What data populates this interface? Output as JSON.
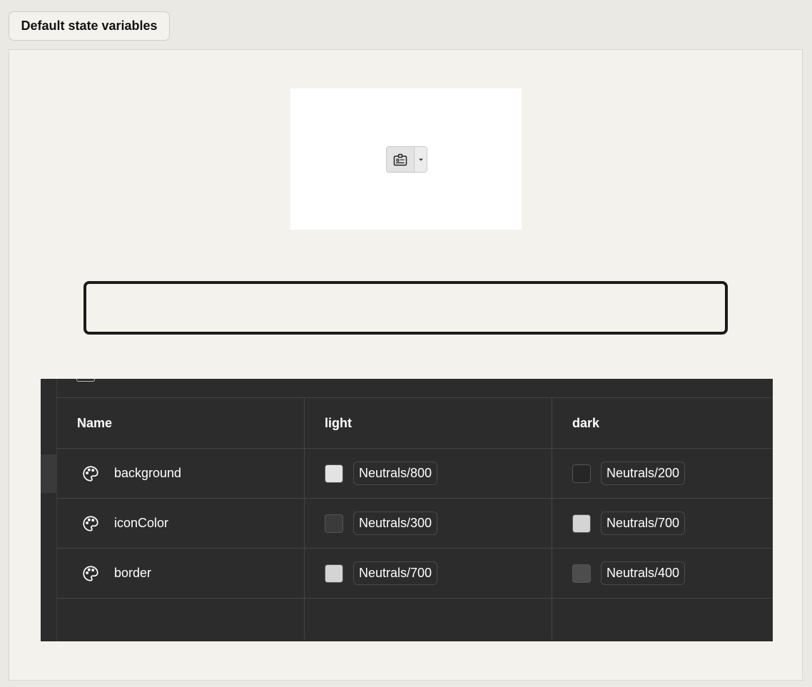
{
  "tab": {
    "label": "Default state variables"
  },
  "preview": {
    "button_icon": "id-card-icon",
    "caret_icon": "caret-down-icon"
  },
  "table": {
    "headers": {
      "name": "Name",
      "light": "light",
      "dark": "dark"
    },
    "rows": [
      {
        "name": "background",
        "icon": "palette-icon",
        "light": {
          "label": "Neutrals/800",
          "swatch": "#e3e3e3"
        },
        "dark": {
          "label": "Neutrals/200",
          "swatch": "#262626"
        }
      },
      {
        "name": "iconColor",
        "icon": "palette-icon",
        "light": {
          "label": "Neutrals/300",
          "swatch": "#3b3b3b"
        },
        "dark": {
          "label": "Neutrals/700",
          "swatch": "#d4d4d4"
        }
      },
      {
        "name": "border",
        "icon": "palette-icon",
        "light": {
          "label": "Neutrals/700",
          "swatch": "#d4d4d4"
        },
        "dark": {
          "label": "Neutrals/400",
          "swatch": "#4d4d4d"
        }
      }
    ]
  }
}
